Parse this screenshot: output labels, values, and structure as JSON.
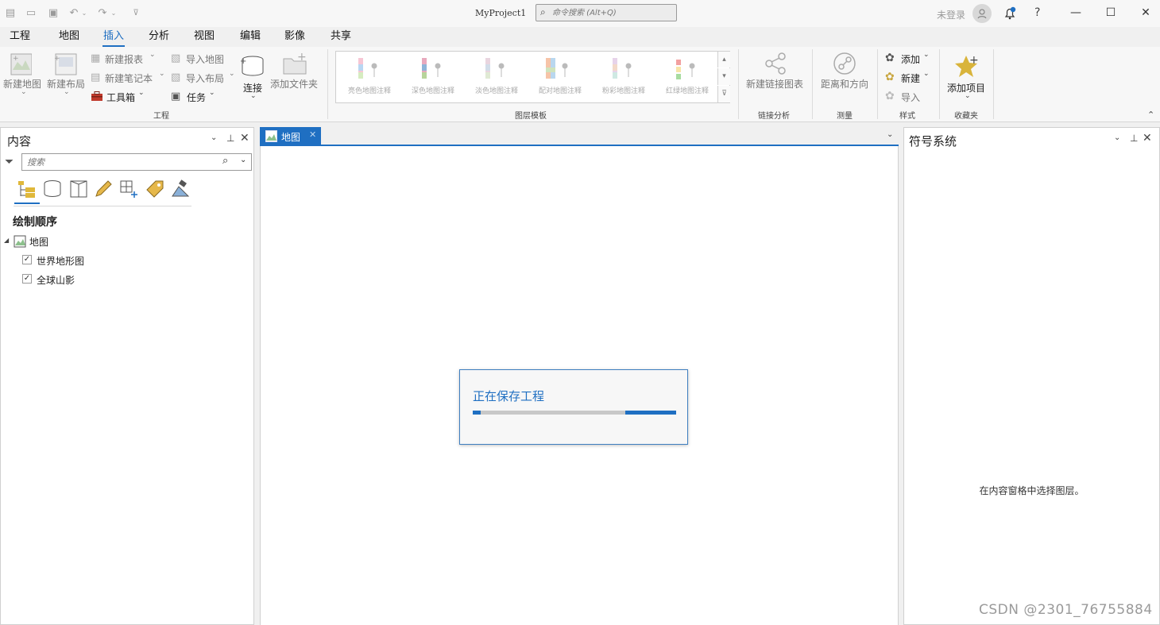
{
  "window": {
    "title": "MyProject1",
    "command_search_placeholder": "命令搜索 (Alt+Q)",
    "signin": "未登录",
    "help": "?"
  },
  "ribbon_tabs": [
    "工程",
    "地图",
    "插入",
    "分析",
    "视图",
    "编辑",
    "影像",
    "共享"
  ],
  "active_tab": "插入",
  "ribbon": {
    "project_group": {
      "label": "工程",
      "new_map": "新建地图",
      "new_layout": "新建布局",
      "new_report": "新建报表",
      "new_notebook": "新建笔记本",
      "toolbox": "工具箱",
      "import_map": "导入地图",
      "import_layout": "导入布局",
      "task": "任务",
      "connect": "连接",
      "add_folder": "添加文件夹"
    },
    "layer_templates_group": {
      "label": "图层模板",
      "items": [
        "亮色地图注释",
        "深色地图注释",
        "淡色地图注释",
        "配对地图注释",
        "粉彩地图注释",
        "红绿地图注释"
      ]
    },
    "link_analysis_group": {
      "label": "链接分析",
      "new_link_chart": "新建链接图表"
    },
    "measure_group": {
      "label": "测量",
      "distance_direction": "距离和方向"
    },
    "styles_group": {
      "label": "样式",
      "add": "添加",
      "new": "新建",
      "import": "导入"
    },
    "favorites_group": {
      "label": "收藏夹",
      "add_item": "添加项目"
    }
  },
  "contents_pane": {
    "title": "内容",
    "search_placeholder": "搜索",
    "section_title": "绘制顺序",
    "map_name": "地图",
    "layers": [
      {
        "name": "世界地形图",
        "checked": true
      },
      {
        "name": "全球山影",
        "checked": true
      }
    ]
  },
  "map_tab": {
    "label": "地图"
  },
  "save_dialog": {
    "message": "正在保存工程",
    "progress_segments": [
      [
        0,
        0.04
      ],
      [
        0.75,
        1.0
      ]
    ]
  },
  "symbology_pane": {
    "title": "符号系统",
    "empty_message": "在内容窗格中选择图层。"
  },
  "watermark": "CSDN @2301_76755884",
  "colors": {
    "accent": "#1f6fc2",
    "pane_bg": "#ffffff",
    "chrome_bg": "#f0f0f0"
  }
}
